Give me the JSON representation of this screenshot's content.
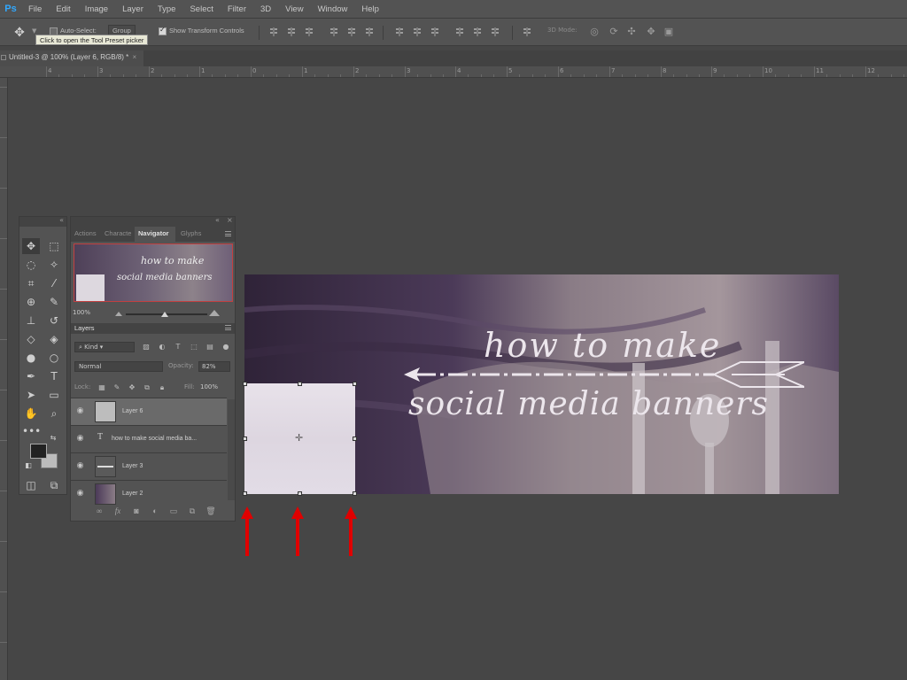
{
  "app": {
    "logo": "Ps",
    "menu": [
      "File",
      "Edit",
      "Image",
      "Layer",
      "Type",
      "Select",
      "Filter",
      "3D",
      "View",
      "Window",
      "Help"
    ]
  },
  "options_bar": {
    "auto_select_label": "Auto-Select:",
    "auto_select_target": "Group",
    "show_transform_label": "Show Transform Controls",
    "tooltip": "Click to open the Tool Preset picker",
    "mode_3d_label": "3D Mode:"
  },
  "document": {
    "tab_title": "Untitled-3 @ 100% (Layer 6, RGB/8) *",
    "close": "×"
  },
  "ruler": {
    "labels": [
      "4",
      "3",
      "2",
      "1",
      "0",
      "1",
      "2",
      "3",
      "4",
      "5",
      "6",
      "7",
      "8",
      "9",
      "10",
      "11",
      "12"
    ]
  },
  "canvas": {
    "title_line1": "how to make",
    "title_line2": "social media banners"
  },
  "panel": {
    "tabs": [
      "Actions",
      "Characte",
      "Navigator",
      "Glyphs"
    ],
    "active_tab": "Navigator",
    "navigator": {
      "zoom": "100%",
      "preview_line1": "how to make",
      "preview_line2": "social media banners"
    },
    "layers": {
      "title": "Layers",
      "filter_kind": "Kind",
      "blend_mode": "Normal",
      "opacity_label": "Opacity:",
      "opacity_value": "82%",
      "lock_label": "Lock:",
      "fill_label": "Fill:",
      "fill_value": "100%",
      "rows": [
        {
          "name": "Layer 6",
          "selected": true
        },
        {
          "name": "how to make  social media ba...",
          "selected": false
        },
        {
          "name": "Layer 3",
          "selected": false
        },
        {
          "name": "Layer 2",
          "selected": false
        }
      ]
    },
    "footer_fx": "fx"
  },
  "colors": {
    "accent_red_arrow": "#e00000",
    "selected_layer": "#6a6a6a",
    "ps_blue": "#31a8ff"
  }
}
